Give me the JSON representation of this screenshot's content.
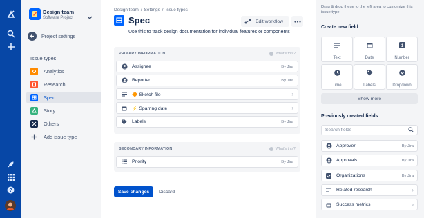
{
  "colors": {
    "rail": "#0747a6",
    "primary": "#0052cc",
    "spec_blue": "#0065ff"
  },
  "project": {
    "name": "Design team",
    "type": "Software Project",
    "settings_label": "Project settings"
  },
  "issue_types": {
    "heading": "Issue types",
    "items": [
      {
        "label": "Analytics",
        "color": "#ff8b00",
        "icon": "analytics-icon"
      },
      {
        "label": "Research",
        "color": "#ff5630",
        "icon": "research-icon"
      },
      {
        "label": "Spec",
        "color": "#0065ff",
        "icon": "spec-icon"
      },
      {
        "label": "Story",
        "color": "#36b37e",
        "icon": "story-icon"
      },
      {
        "label": "Others",
        "color": "#172b4d",
        "icon": "others-icon"
      }
    ],
    "add_label": "Add issue type"
  },
  "breadcrumbs": [
    "Design team",
    "Settings",
    "Issue types"
  ],
  "page": {
    "title": "Spec",
    "description": "Use this to track design documentation for individual features or components",
    "edit_workflow": "Edit workflow"
  },
  "primary": {
    "title": "PRIMARY INFORMATION",
    "hint": "What's this?",
    "rows": [
      {
        "label": "Assignee",
        "right": "By Jira",
        "icon": "person-icon"
      },
      {
        "label": "Reporter",
        "right": "By Jira",
        "icon": "person-icon"
      },
      {
        "label": "🔶 Sketch file",
        "right": "",
        "icon": "text-lines-icon"
      },
      {
        "label": "⚡ Sparring date",
        "right": "",
        "icon": "calendar-icon"
      },
      {
        "label": "Labels",
        "right": "By Jira",
        "icon": "tag-icon"
      }
    ]
  },
  "secondary": {
    "title": "SECONDARY INFORMATION",
    "hint": "What's this?",
    "rows": [
      {
        "label": "Priority",
        "right": "By Jira",
        "icon": "list-icon"
      }
    ]
  },
  "actions": {
    "save": "Save changes",
    "discard": "Discard"
  },
  "right": {
    "help": "Drag & drop these to the left area to customize this issue type",
    "create_heading": "Create new field",
    "tiles": [
      {
        "label": "Text",
        "icon": "text-icon"
      },
      {
        "label": "Date",
        "icon": "calendar-icon"
      },
      {
        "label": "Number",
        "icon": "number-icon"
      },
      {
        "label": "Time",
        "icon": "clock-icon"
      },
      {
        "label": "Labels",
        "icon": "tag-icon"
      },
      {
        "label": "Dropdown",
        "icon": "dropdown-icon"
      }
    ],
    "show_more": "Show more",
    "prev_heading": "Previously created fields",
    "search_placeholder": "Search fields",
    "fields": [
      {
        "label": "Approver",
        "right": "By Jira",
        "icon": "person-icon"
      },
      {
        "label": "Approvals",
        "right": "By Jira",
        "icon": "person-icon"
      },
      {
        "label": "Organizations",
        "right": "By Jira",
        "icon": "checkbox-icon"
      },
      {
        "label": "Related research",
        "right": "",
        "icon": "text-lines-icon"
      },
      {
        "label": "Success metrics",
        "right": "",
        "icon": "calendar-icon"
      }
    ]
  }
}
